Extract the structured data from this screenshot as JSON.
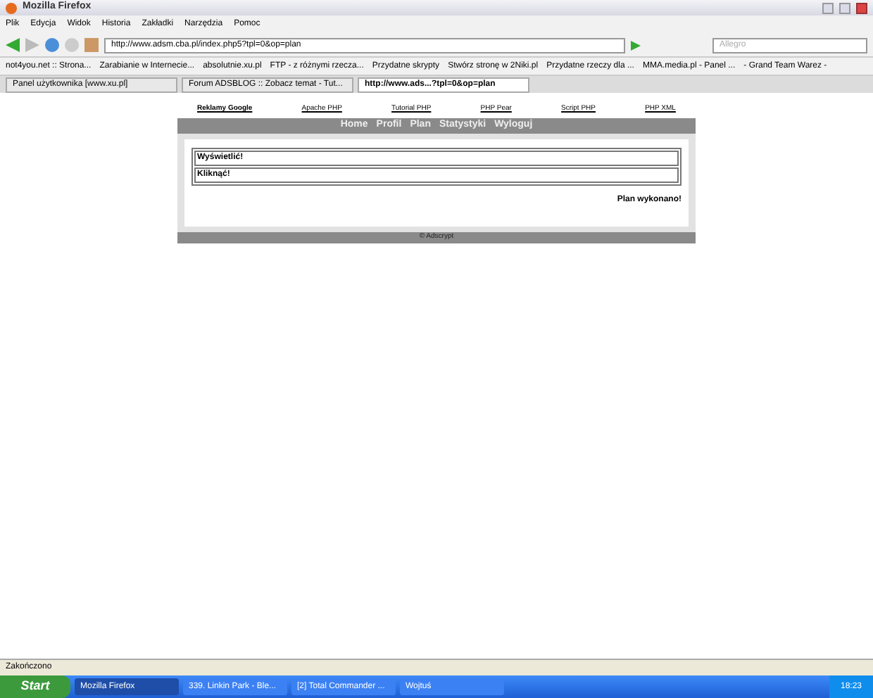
{
  "window": {
    "title": "Mozilla Firefox"
  },
  "menu": [
    "Plik",
    "Edycja",
    "Widok",
    "Historia",
    "Zakładki",
    "Narzędzia",
    "Pomoc"
  ],
  "address": {
    "value": "http://www.adsm.cba.pl/index.php5?tpl=0&op=plan"
  },
  "search": {
    "placeholder": "Allegro"
  },
  "bookmarks": [
    "not4you.net :: Strona...",
    "Zarabianie w Internecie...",
    "absolutnie.xu.pl",
    "FTP - z różnymi rzecza...",
    "Przydatne skrypty",
    "Stwórz stronę w 2Niki.pl",
    "Przydatne rzeczy dla ...",
    "MMA.media.pl - Panel ...",
    "- Grand Team Warez -"
  ],
  "tabs": [
    {
      "label": "Panel użytkownika   [www.xu.pl]",
      "selected": false
    },
    {
      "label": "Forum ADSBLOG :: Zobacz temat - Tut...",
      "selected": false
    },
    {
      "label": "http://www.ads...?tpl=0&op=plan",
      "selected": true
    }
  ],
  "page": {
    "ad_links": [
      {
        "label": "Reklamy Google",
        "selected": true
      },
      {
        "label": "Apache PHP",
        "selected": false
      },
      {
        "label": "Tutorial PHP",
        "selected": false
      },
      {
        "label": "PHP Pear",
        "selected": false
      },
      {
        "label": "Script PHP",
        "selected": false
      },
      {
        "label": "PHP XML",
        "selected": false
      }
    ],
    "nav": [
      "Home",
      "Profil",
      "Plan",
      "Statystyki",
      "Wyloguj"
    ],
    "rows": [
      "Wyświetlić!",
      "Kliknąć!"
    ],
    "message": "Plan wykonano!",
    "footer": "© Adscrypt"
  },
  "status_bar": "Zakończono",
  "taskbar": {
    "start": "Start",
    "items": [
      {
        "label": "Mozilla Firefox",
        "selected": true
      },
      {
        "label": "339. Linkin Park - Ble...",
        "selected": false
      },
      {
        "label": "[2] Total Commander ...",
        "selected": false
      },
      {
        "label": "Wojtuś",
        "selected": false
      }
    ],
    "clock": "18:23"
  }
}
